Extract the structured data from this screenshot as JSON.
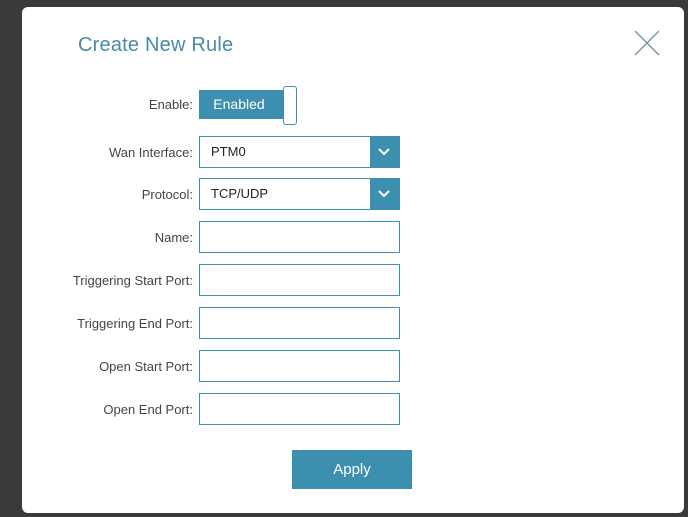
{
  "dialog": {
    "title": "Create New Rule",
    "close_icon": "close-x-icon"
  },
  "form": {
    "enable": {
      "label": "Enable:",
      "value": "Enabled",
      "state": true
    },
    "wan_interface": {
      "label": "Wan Interface:",
      "value": "PTM0"
    },
    "protocol": {
      "label": "Protocol:",
      "value": "TCP/UDP"
    },
    "name": {
      "label": "Name:",
      "value": ""
    },
    "triggering_start_port": {
      "label": "Triggering Start Port:",
      "value": ""
    },
    "triggering_end_port": {
      "label": "Triggering End Port:",
      "value": ""
    },
    "open_start_port": {
      "label": "Open Start Port:",
      "value": ""
    },
    "open_end_port": {
      "label": "Open End Port:",
      "value": ""
    }
  },
  "actions": {
    "apply_label": "Apply"
  },
  "colors": {
    "accent": "#3d8fb0",
    "title": "#4a8aa6",
    "backdrop": "#3a3a3a"
  }
}
